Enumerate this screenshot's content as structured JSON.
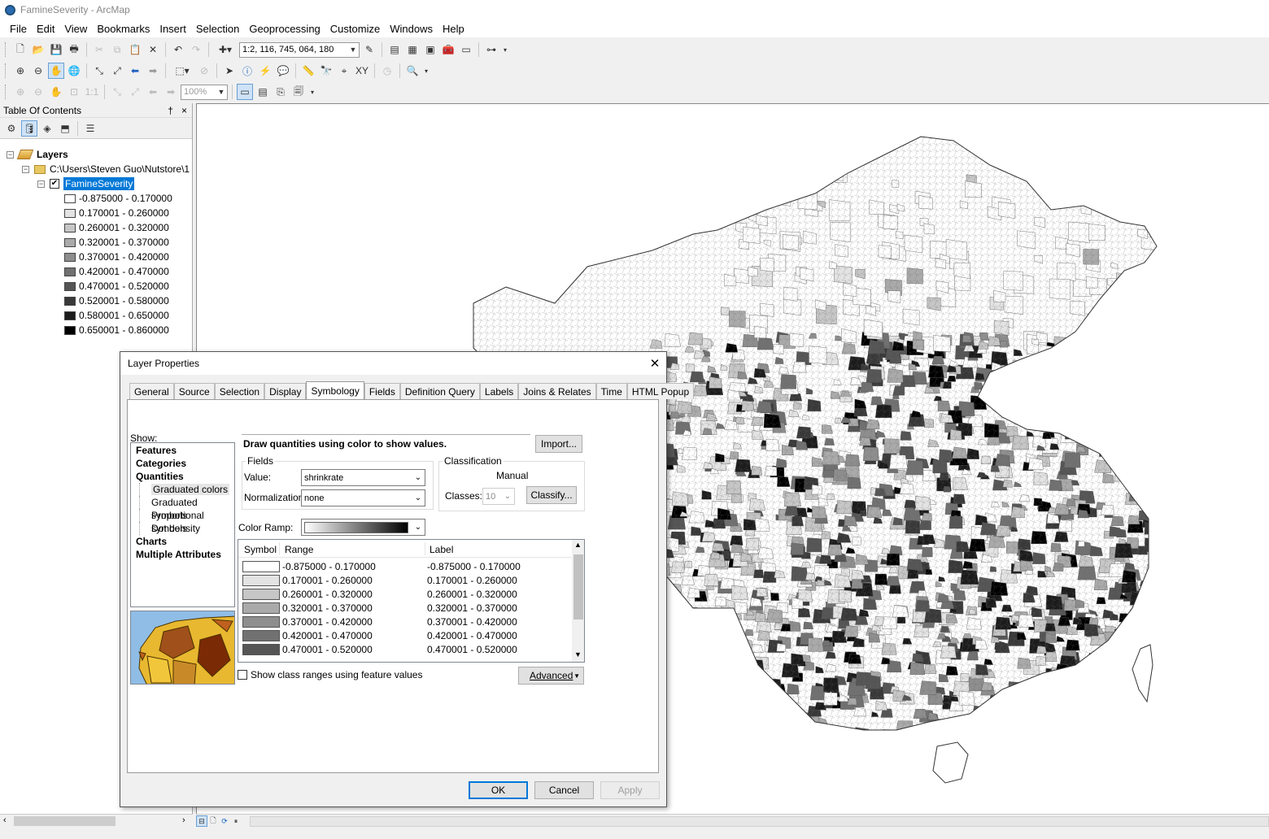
{
  "window": {
    "title": "FamineSeverity - ArcMap"
  },
  "menu": [
    "File",
    "Edit",
    "View",
    "Bookmarks",
    "Insert",
    "Selection",
    "Geoprocessing",
    "Customize",
    "Windows",
    "Help"
  ],
  "toolbar": {
    "scale": "1:2, 116, 745, 064, 180",
    "zoom_percent": "100%"
  },
  "toc": {
    "title": "Table Of Contents",
    "pin": "†",
    "close": "×",
    "root": "Layers",
    "folder": "C:\\Users\\Steven Guo\\Nutstore\\1",
    "layer": "FamineSeverity",
    "layer_visible": true,
    "classes": [
      {
        "label": "-0.875000 - 0.170000",
        "color": "#ffffff"
      },
      {
        "label": "0.170001 - 0.260000",
        "color": "#e3e3e3"
      },
      {
        "label": "0.260001 - 0.320000",
        "color": "#c6c6c6"
      },
      {
        "label": "0.320001 - 0.370000",
        "color": "#aaaaaa"
      },
      {
        "label": "0.370001 - 0.420000",
        "color": "#8e8e8e"
      },
      {
        "label": "0.420001 - 0.470000",
        "color": "#717171"
      },
      {
        "label": "0.470001 - 0.520000",
        "color": "#555555"
      },
      {
        "label": "0.520001 - 0.580000",
        "color": "#393939"
      },
      {
        "label": "0.580001 - 0.650000",
        "color": "#1c1c1c"
      },
      {
        "label": "0.650001 - 0.860000",
        "color": "#000000"
      }
    ]
  },
  "dialog": {
    "title": "Layer Properties",
    "close": "✕",
    "tabs": [
      "General",
      "Source",
      "Selection",
      "Display",
      "Symbology",
      "Fields",
      "Definition Query",
      "Labels",
      "Joins & Relates",
      "Time",
      "HTML Popup"
    ],
    "active_tab": "Symbology",
    "show_label": "Show:",
    "show_tree": [
      {
        "label": "Features",
        "level": 0
      },
      {
        "label": "Categories",
        "level": 0
      },
      {
        "label": "Quantities",
        "level": 0
      },
      {
        "label": "Graduated colors",
        "level": 1,
        "selected": true
      },
      {
        "label": "Graduated symbols",
        "level": 1
      },
      {
        "label": "Proportional symbols",
        "level": 1
      },
      {
        "label": "Dot density",
        "level": 1
      },
      {
        "label": "Charts",
        "level": 0
      },
      {
        "label": "Multiple Attributes",
        "level": 0
      }
    ],
    "description": "Draw quantities using color to show values.",
    "import_button": "Import...",
    "fields_group": "Fields",
    "value_label": "Value:",
    "value": "shrinkrate",
    "normalization_label": "Normalization:",
    "normalization": "none",
    "classification_group": "Classification",
    "method": "Manual",
    "classes_label": "Classes:",
    "classes": "10",
    "classify_button": "Classify...",
    "color_ramp_label": "Color Ramp:",
    "table_headers": {
      "symbol": "Symbol",
      "range": "Range",
      "label": "Label"
    },
    "rows": [
      {
        "range": "-0.875000 - 0.170000",
        "label": "-0.875000 - 0.170000",
        "color": "#ffffff"
      },
      {
        "range": "0.170001 - 0.260000",
        "label": "0.170001 - 0.260000",
        "color": "#e3e3e3"
      },
      {
        "range": "0.260001 - 0.320000",
        "label": "0.260001 - 0.320000",
        "color": "#c6c6c6"
      },
      {
        "range": "0.320001 - 0.370000",
        "label": "0.320001 - 0.370000",
        "color": "#aaaaaa"
      },
      {
        "range": "0.370001 - 0.420000",
        "label": "0.370001 - 0.420000",
        "color": "#8e8e8e"
      },
      {
        "range": "0.420001 - 0.470000",
        "label": "0.420001 - 0.470000",
        "color": "#717171"
      },
      {
        "range": "0.470001 - 0.520000",
        "label": "0.470001 - 0.520000",
        "color": "#555555"
      }
    ],
    "show_ranges_checkbox": "Show class ranges using feature values",
    "advanced_button": "Advanced",
    "ok": "OK",
    "cancel": "Cancel",
    "apply": "Apply"
  }
}
